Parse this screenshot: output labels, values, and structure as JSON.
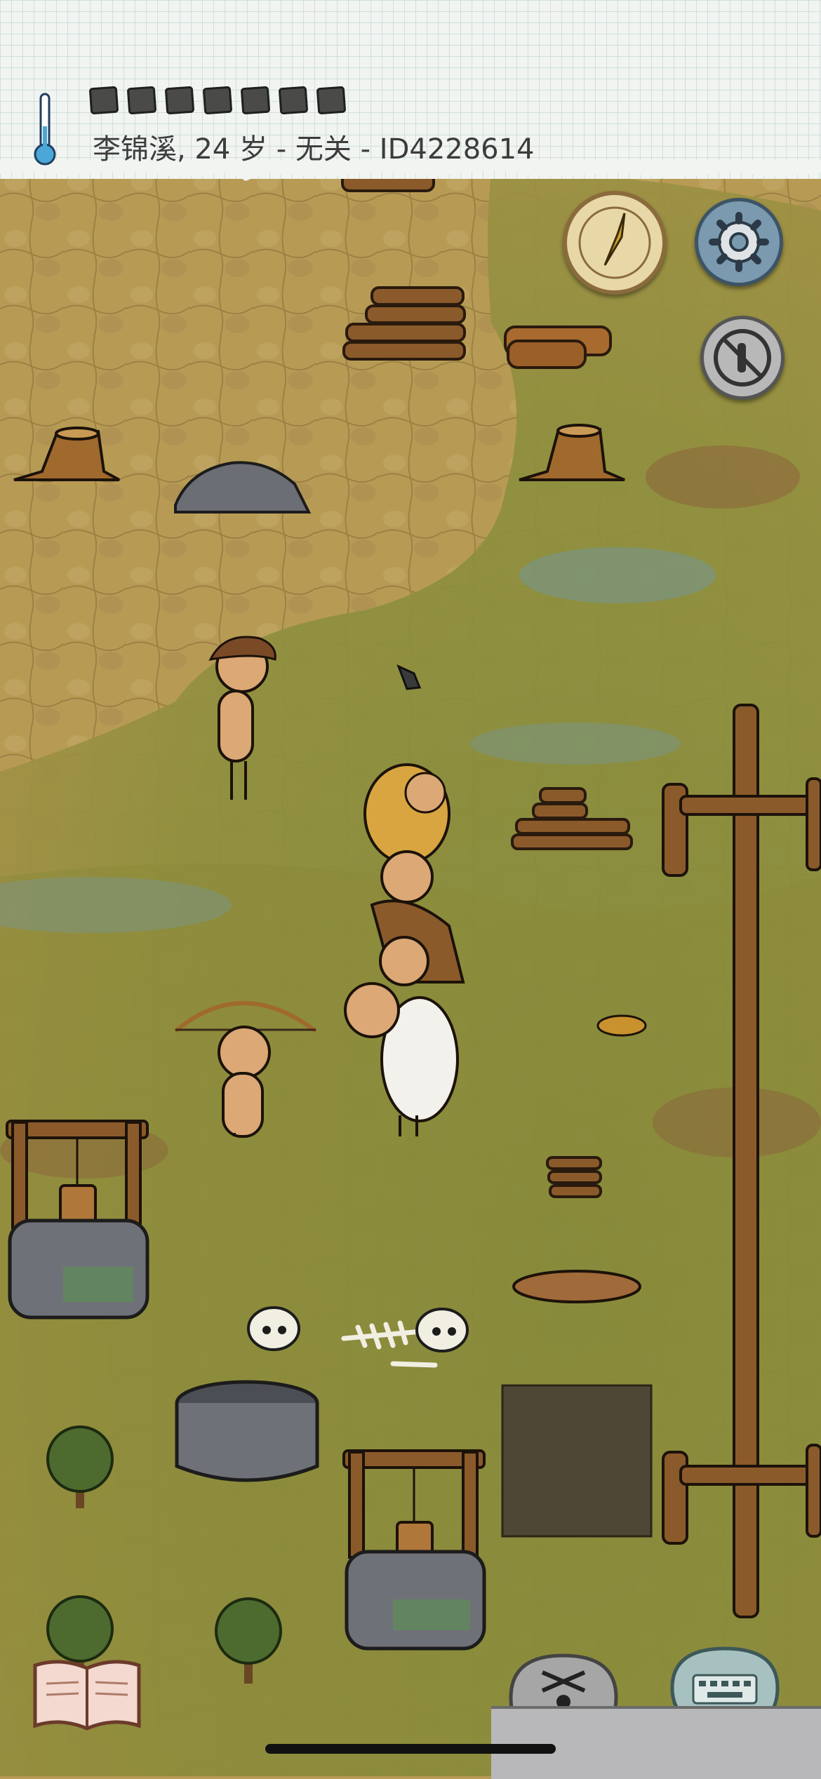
{
  "hud": {
    "player_info": "李锦溪, 24 岁 - 无关 - ID4228614",
    "food_pips_filled": 7,
    "food_pips_total": 7,
    "temperature_icon": "thermometer-icon"
  },
  "buttons": {
    "compass": "compass-icon",
    "settings": "gear-icon",
    "no_kill": "no-kill-icon",
    "recipe_book": "book-icon",
    "emote": "puppet-icon",
    "chat": "keyboard-icon"
  },
  "colors": {
    "ground_dirt": "#b79b55",
    "grass": "#8a8f3c",
    "paper": "#f1f4f1",
    "stone": "#6b6e75",
    "wood": "#8b5a2b"
  }
}
